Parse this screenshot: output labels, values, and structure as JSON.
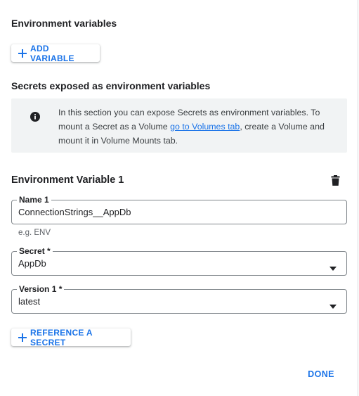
{
  "environment_variables": {
    "title": "Environment variables",
    "add_button_label": "ADD VARIABLE"
  },
  "secrets": {
    "title": "Secrets exposed as environment variables",
    "info": {
      "icon": "info-icon",
      "text_before_link": "In this section you can expose Secrets as environment variables. To mount a Secret as a Volume ",
      "link_text": "go to Volumes tab",
      "text_after_link": ", create a Volume and mount it in Volume Mounts tab."
    }
  },
  "env_var_1": {
    "title": "Environment Variable 1",
    "delete_icon": "trash-icon",
    "name": {
      "label": "Name 1",
      "value": "ConnectionStrings__AppDb",
      "hint": "e.g. ENV"
    },
    "secret": {
      "label": "Secret *",
      "value": "AppDb"
    },
    "version": {
      "label": "Version 1 *",
      "value": "latest"
    }
  },
  "reference_secret_label": "REFERENCE A SECRET",
  "done_label": "DONE",
  "colors": {
    "accent": "#1a73e8",
    "info_background": "#f1f3f4",
    "field_border": "#80868b"
  }
}
